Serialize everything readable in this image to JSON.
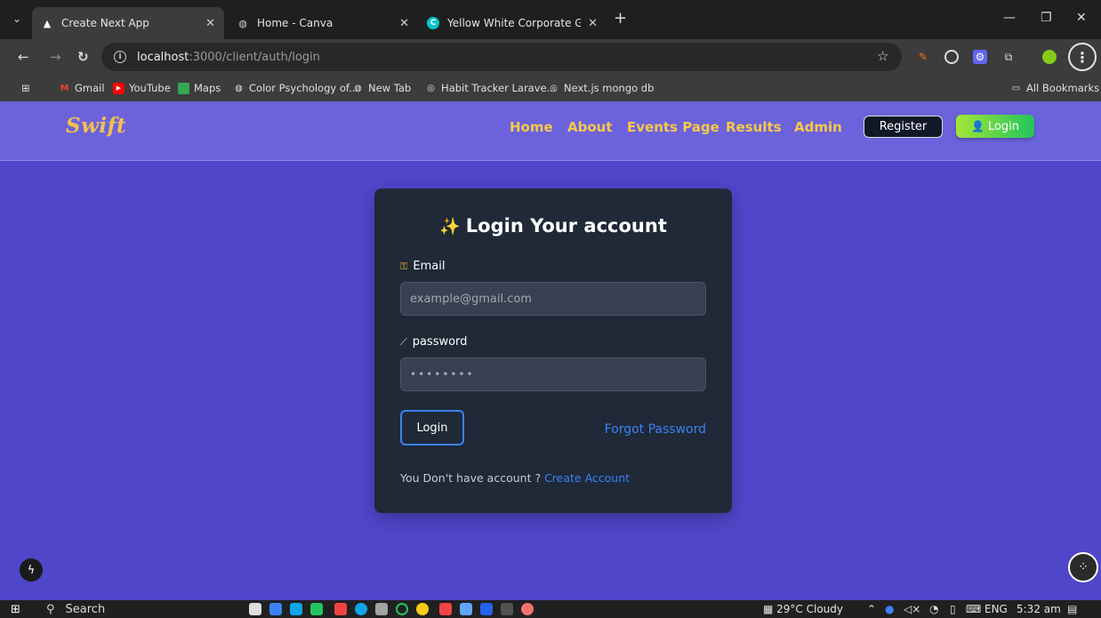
{
  "browser": {
    "tabs": [
      {
        "title": "Create Next App",
        "icon": "triangle-icon",
        "active": true
      },
      {
        "title": "Home - Canva",
        "icon": "globe-icon",
        "active": false
      },
      {
        "title": "Yellow White Corporate Geome",
        "icon": "canva-icon",
        "active": false
      }
    ],
    "url_host": "localhost",
    "url_path": ":3000/client/auth/login",
    "bookmarks": [
      "Gmail",
      "YouTube",
      "Maps",
      "Color Psychology of...",
      "New Tab",
      "Habit Tracker Larave...",
      "Next.js mongo db"
    ],
    "all_bookmarks": "All Bookmarks"
  },
  "navbar": {
    "logo": "Swift",
    "links": [
      "Home",
      "About",
      "Events Page",
      "Results",
      "Admin"
    ],
    "register": "Register",
    "login": "Login"
  },
  "login_card": {
    "title_icon": "✨",
    "title": "Login Your account",
    "email_label": "Email",
    "email_placeholder": "example@gmail.com",
    "password_label": "password",
    "password_value": "••••••••",
    "submit": "Login",
    "forgot": "Forgot Password",
    "signup_prompt": "You Don't have account ?",
    "signup_link": "Create Account"
  },
  "taskbar": {
    "search": "Search",
    "weather": "29°C Cloudy",
    "lang": "ENG",
    "time": "5:32 am"
  },
  "colors": {
    "page_bg": "#4f46c9",
    "navbar_bg": "#6c63dc",
    "nav_link": "#f7c948",
    "card_bg": "#1f2937",
    "accent_blue": "#3b82f6",
    "login_btn": "#22c55e"
  }
}
